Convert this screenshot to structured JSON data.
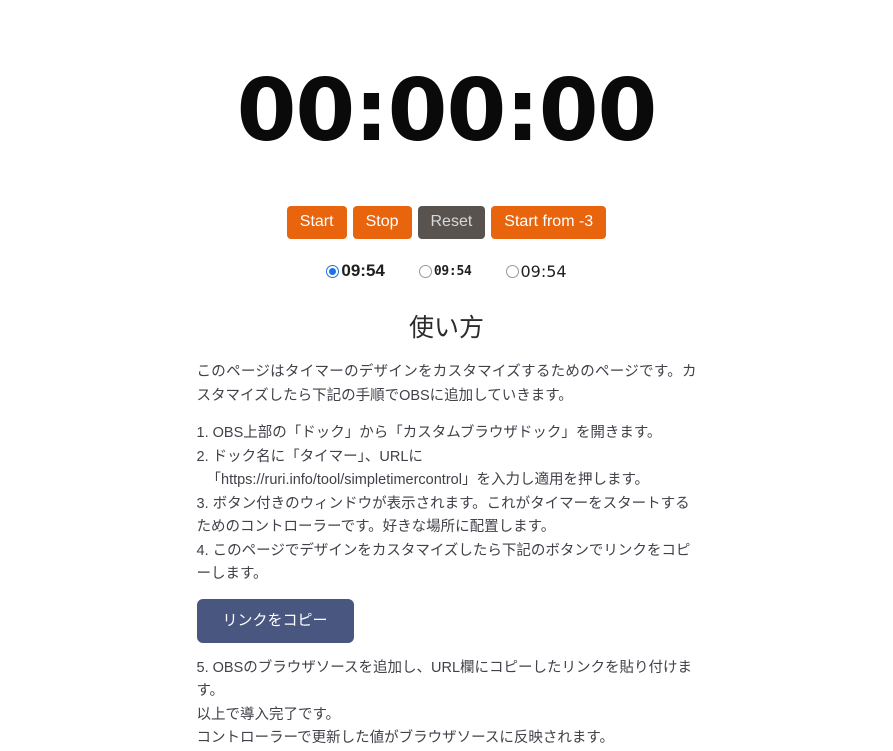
{
  "timer": {
    "display": "00:00:00"
  },
  "controls": {
    "start_label": "Start",
    "stop_label": "Stop",
    "reset_label": "Reset",
    "start_from_label": "Start from -3",
    "orange_color": "#e8650d",
    "reset_color": "#58534f"
  },
  "font_options": {
    "selected_index": 0,
    "items": [
      {
        "label": "09:54",
        "selected": true
      },
      {
        "label": "09:54",
        "selected": false
      },
      {
        "label": "09:54",
        "selected": false
      }
    ],
    "accent_color": "#1a73e8"
  },
  "howto": {
    "title": "使い方",
    "intro": "このページはタイマーのデザインをカスタマイズするためのページです。カスタマイズしたら下記の手順でOBSに追加していきます。",
    "step1": "1. OBS上部の「ドック」から「カスタムブラウザドック」を開きます。",
    "step2": "2. ドック名に「タイマー」、URLに",
    "step2_url": "「https://ruri.info/tool/simpletimercontrol」を入力し適用を押します。",
    "step3": "3. ボタン付きのウィンドウが表示されます。これがタイマーをスタートするためのコントローラーです。好きな場所に配置します。",
    "step4": "4. このページでデザインをカスタマイズしたら下記のボタンでリンクをコピーします。",
    "copy_link_label": "リンクをコピー",
    "copy_button_color": "#495680",
    "step5": "5. OBSのブラウザソースを追加し、URL欄にコピーしたリンクを貼り付けます。",
    "outro1": "以上で導入完了です。",
    "outro2": "コントローラーで更新した値がブラウザソースに反映されます。"
  }
}
